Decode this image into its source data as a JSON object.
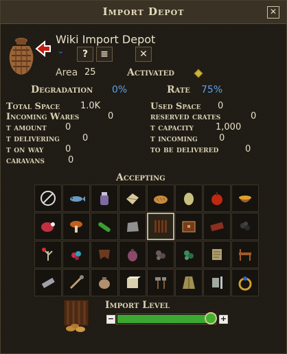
{
  "window": {
    "title": "Import Depot",
    "close_label": "✕"
  },
  "building": {
    "name": "Wiki Import Depot",
    "chevron": "⌄",
    "help_label": "?",
    "menu_label": "≡",
    "x_label": "✕",
    "area_label": "Area",
    "area_value": "25",
    "status": "Activated"
  },
  "stats": {
    "degradation_label": "Degradation",
    "degradation_value": "0%",
    "rate_label": "Rate",
    "rate_value": "75%",
    "left": [
      {
        "label": "Total Space",
        "value": "1.0K"
      },
      {
        "label": "Incoming Wares",
        "value": "0"
      },
      {
        "label": "t amount",
        "value": "0"
      },
      {
        "label": "t delivering",
        "value": "0"
      },
      {
        "label": "t on way",
        "value": "0"
      },
      {
        "label": "caravans",
        "value": "0"
      }
    ],
    "right": [
      {
        "label": "Used Space",
        "value": "0"
      },
      {
        "label": "reserved crates",
        "value": "0"
      },
      {
        "label": "t capacity",
        "value": "1,000"
      },
      {
        "label": "t incoming",
        "value": "0"
      },
      {
        "label": "to be delivered",
        "value": "0"
      }
    ]
  },
  "accepting": {
    "title": "Accepting",
    "items": [
      {
        "icon": "none-icon",
        "selected": false
      },
      {
        "icon": "fish-icon",
        "selected": false
      },
      {
        "icon": "jar-icon",
        "selected": false
      },
      {
        "icon": "cloth-bundle-icon",
        "selected": false
      },
      {
        "icon": "bread-icon",
        "selected": false
      },
      {
        "icon": "egg-icon",
        "selected": false
      },
      {
        "icon": "apple-icon",
        "selected": false
      },
      {
        "icon": "bowl-icon",
        "selected": false
      },
      {
        "icon": "meat-icon",
        "selected": false
      },
      {
        "icon": "mushroom-icon",
        "selected": false
      },
      {
        "icon": "cucumber-icon",
        "selected": false
      },
      {
        "icon": "stone-icon",
        "selected": false
      },
      {
        "icon": "crate-icon",
        "selected": true
      },
      {
        "icon": "chest-icon",
        "selected": false
      },
      {
        "icon": "brick-icon",
        "selected": false
      },
      {
        "icon": "coal-icon",
        "selected": false
      },
      {
        "icon": "herb-icon",
        "selected": false
      },
      {
        "icon": "berries-icon",
        "selected": false
      },
      {
        "icon": "leather-icon",
        "selected": false
      },
      {
        "icon": "sack-icon",
        "selected": false
      },
      {
        "icon": "ore-icon",
        "selected": false
      },
      {
        "icon": "green-ore-icon",
        "selected": false
      },
      {
        "icon": "scroll-icon",
        "selected": false
      },
      {
        "icon": "furniture-icon",
        "selected": false
      },
      {
        "icon": "iron-bar-icon",
        "selected": false
      },
      {
        "icon": "tools-icon",
        "selected": false
      },
      {
        "icon": "pot-icon",
        "selected": false
      },
      {
        "icon": "block-icon",
        "selected": false
      },
      {
        "icon": "hammer-icon",
        "selected": false
      },
      {
        "icon": "coat-icon",
        "selected": false
      },
      {
        "icon": "armor-icon",
        "selected": false
      },
      {
        "icon": "ring-icon",
        "selected": false
      }
    ]
  },
  "import_level": {
    "label": "Import Level",
    "minus": "−",
    "plus": "+",
    "level_fraction": 0.95
  },
  "colors": {
    "bar_fill": "#3ca832",
    "status_diamond": "#c9b43a",
    "link_blue": "#5ea2e8"
  }
}
